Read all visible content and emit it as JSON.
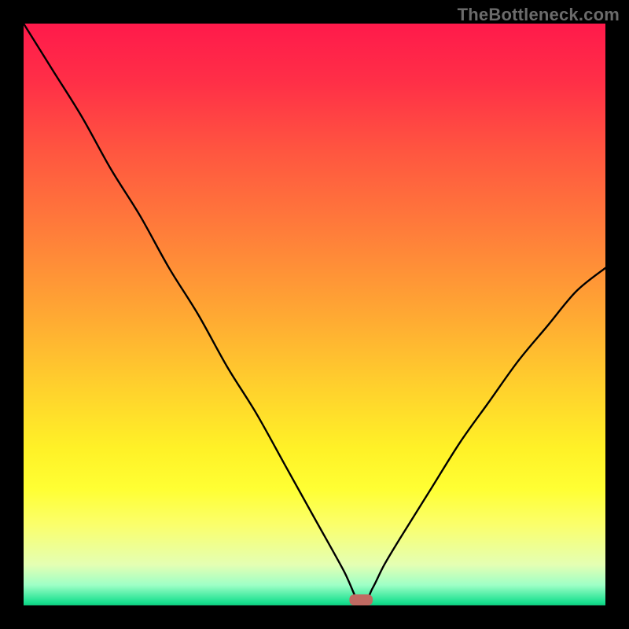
{
  "watermark": "TheBottleneck.com",
  "chart_data": {
    "type": "line",
    "title": "",
    "xlabel": "",
    "ylabel": "",
    "xlim": [
      0,
      100
    ],
    "ylim": [
      0,
      100
    ],
    "optimal_marker": {
      "x": 58,
      "width": 4,
      "color": "#c06a62"
    },
    "series": [
      {
        "name": "bottleneck-curve",
        "x": [
          0,
          5,
          10,
          15,
          20,
          25,
          30,
          35,
          40,
          45,
          50,
          55,
          58,
          60,
          62,
          65,
          70,
          75,
          80,
          85,
          90,
          95,
          100
        ],
        "y": [
          100,
          92,
          84,
          75,
          67,
          58,
          50,
          41,
          33,
          24,
          15,
          6,
          0,
          3,
          7,
          12,
          20,
          28,
          35,
          42,
          48,
          54,
          58
        ]
      }
    ],
    "background_gradient": {
      "stops": [
        {
          "offset": 0.0,
          "color": "#ff1a4b"
        },
        {
          "offset": 0.1,
          "color": "#ff2f47"
        },
        {
          "offset": 0.22,
          "color": "#ff5640"
        },
        {
          "offset": 0.36,
          "color": "#ff7e3a"
        },
        {
          "offset": 0.5,
          "color": "#ffa833"
        },
        {
          "offset": 0.62,
          "color": "#ffcf2d"
        },
        {
          "offset": 0.73,
          "color": "#fff127"
        },
        {
          "offset": 0.8,
          "color": "#ffff33"
        },
        {
          "offset": 0.86,
          "color": "#fbff6a"
        },
        {
          "offset": 0.93,
          "color": "#e4ffb3"
        },
        {
          "offset": 0.965,
          "color": "#9effc6"
        },
        {
          "offset": 0.995,
          "color": "#18e08f"
        },
        {
          "offset": 1.0,
          "color": "#10c87e"
        }
      ]
    }
  }
}
